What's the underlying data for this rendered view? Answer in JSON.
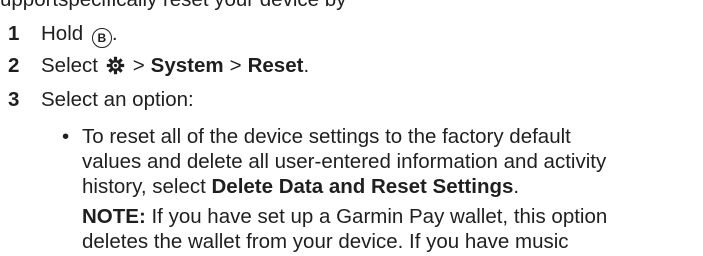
{
  "intro_fragment": "upportspecifically reset your device by",
  "steps": [
    {
      "number": "1",
      "pre": "Hold",
      "button_icon": "B-button-circled",
      "button_glyph": "B",
      "post": "."
    },
    {
      "number": "2",
      "pre": "Select",
      "gear_icon": "settings-gear-icon",
      "sep1": ">",
      "item1": "System",
      "sep2": ">",
      "item2": "Reset",
      "post": "."
    },
    {
      "number": "3",
      "text": "Select an option:"
    }
  ],
  "bullet": {
    "marker": "•",
    "line1": "To reset all of the device settings to the factory default",
    "line2": "values and delete all user-entered information and activity",
    "line3_pre": "history, select ",
    "line3_bold": "Delete Data and Reset Settings",
    "line3_post": "."
  },
  "note": {
    "label": "NOTE:",
    "line1": " If you have set up a Garmin Pay wallet, this option",
    "line2": "deletes the wallet from your device. If you have music"
  }
}
